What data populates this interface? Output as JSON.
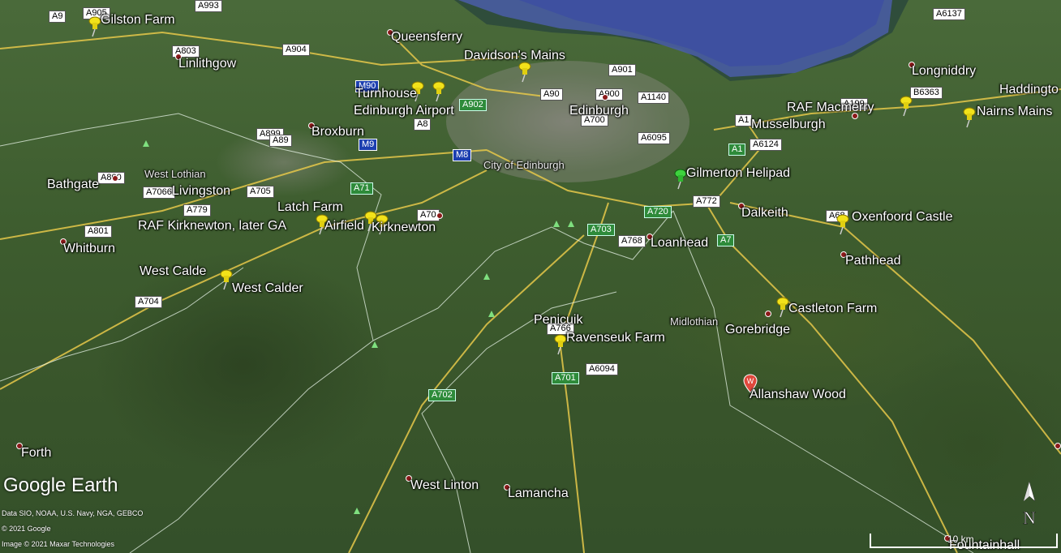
{
  "map": {
    "credits": {
      "brand": "Google Earth",
      "line1": "Data SIO, NOAA, U.S. Navy, NGA, GEBCO",
      "line2": "© 2021 Google",
      "line3": "Image © 2021 Maxar Technologies"
    },
    "scale": "10 km",
    "compass": "N",
    "places": {
      "gilston_farm": "Gilston Farm",
      "queensferry": "Queensferry",
      "linlithgow": "Linlithgow",
      "davidsons_mains": "Davidson's Mains",
      "longniddry": "Longniddry",
      "haddington": "Haddingto",
      "turnhouse": "Turnhouse",
      "edinburgh_airport": "Edinburgh Airport",
      "edinburgh": "Edinburgh",
      "raf_macmerry": "RAF Macmerry",
      "nairns_mains": "Nairns Mains",
      "musselburgh": "Musselburgh",
      "broxburn": "Broxburn",
      "city_of_edinburgh": "City of Edinburgh",
      "gilmerton_helipad": "Gilmerton Helipad",
      "bathgate": "Bathgate",
      "west_lothian": "West Lothian",
      "livingston": "Livingston",
      "latch_farm": "Latch Farm",
      "dalkeith": "Dalkeith",
      "oxenfoord_castle": "Oxenfoord Castle",
      "raf_kirknewton": "RAF Kirknewton, later GA",
      "airfield": "Airfield",
      "kirknewton": "Kirknewton",
      "whitburn": "Whitburn",
      "loanhead": "Loanhead",
      "pathhead": "Pathhead",
      "west_calde": "West Calde",
      "west_calder": "West Calder",
      "castleton_farm": "Castleton Farm",
      "midlothian": "Midlothian",
      "penicuik": "Penicuik",
      "gorebridge": "Gorebridge",
      "ravenseuk_farm": "Ravenseuk Farm",
      "allanshaw_wood": "Allanshaw Wood",
      "forth": "Forth",
      "west_linton": "West Linton",
      "lamancha": "Lamancha",
      "fountainhall": "Fountainhall"
    },
    "roads": {
      "a9": "A9",
      "a905": "A905",
      "a993": "A993",
      "a6137": "A6137",
      "a803": "A803",
      "a904": "A904",
      "a901": "A901",
      "a6363": "B6363",
      "m90": "M90",
      "a902": "A902",
      "a90": "A90",
      "a900": "A900",
      "a1140": "A1140",
      "a199": "A199",
      "a8": "A8",
      "a700": "A700",
      "a899": "A899",
      "a89": "A89",
      "m9": "M9",
      "m8": "M8",
      "a6095": "A6095",
      "a1": "A1",
      "a6124": "A6124",
      "a800": "A800",
      "a7066": "A7066",
      "a705": "A705",
      "a71": "A71",
      "a720": "A720",
      "a772": "A772",
      "a779": "A779",
      "a70": "A70",
      "a703": "A703",
      "a68": "A68",
      "a801": "A801",
      "a768": "A768",
      "a7": "A7",
      "a704": "A704",
      "a766": "A766",
      "a6094": "A6094",
      "a701": "A701",
      "a702": "A702"
    }
  }
}
